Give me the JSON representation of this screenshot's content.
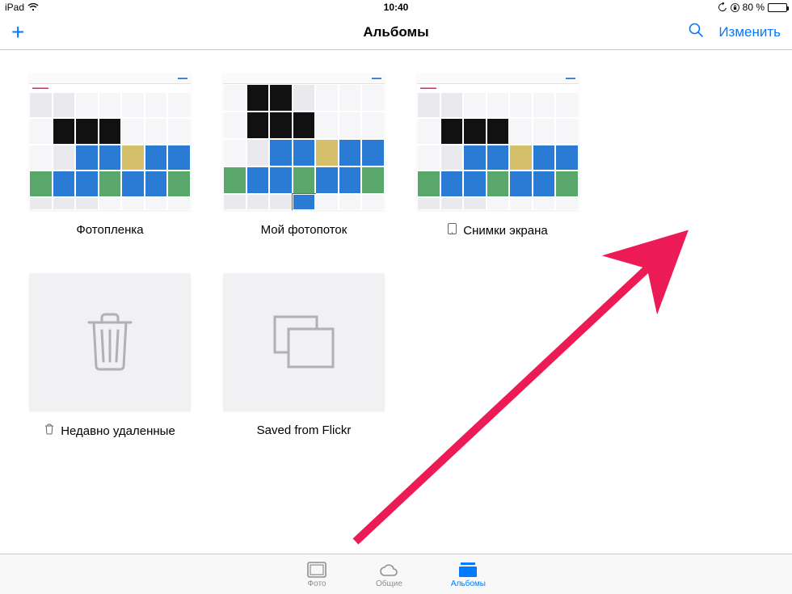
{
  "status": {
    "device": "iPad",
    "time": "10:40",
    "battery_pct": "80 %"
  },
  "nav": {
    "title": "Альбомы",
    "edit": "Изменить"
  },
  "albums": [
    {
      "label": "Фотопленка",
      "kind": "collage"
    },
    {
      "label": "Мой фотопоток",
      "kind": "collage"
    },
    {
      "label": "Снимки экрана",
      "kind": "collage",
      "icon": "device"
    },
    {
      "label": "Недавно удаленные",
      "kind": "trash",
      "icon": "trash"
    },
    {
      "label": "Saved from Flickr",
      "kind": "stack"
    }
  ],
  "tabs": [
    {
      "label": "Фото",
      "icon": "photos",
      "active": false
    },
    {
      "label": "Общие",
      "icon": "cloud",
      "active": false
    },
    {
      "label": "Альбомы",
      "icon": "albums",
      "active": true
    }
  ]
}
